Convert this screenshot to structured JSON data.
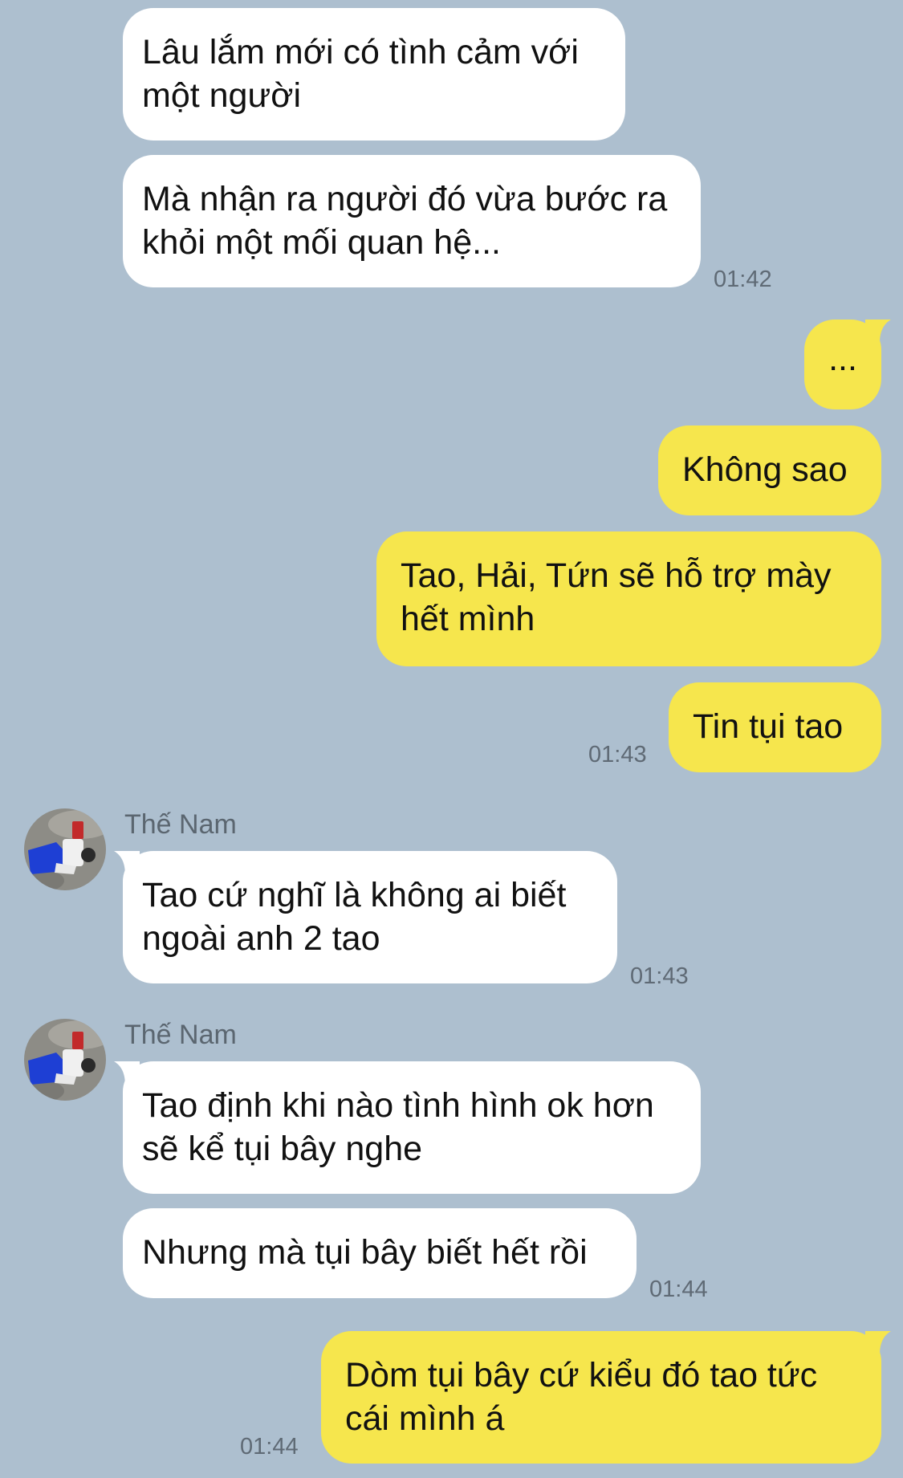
{
  "colors": {
    "background": "#adbfcf",
    "incoming_bubble": "#ffffff",
    "outgoing_bubble": "#f6e64d"
  },
  "messages": {
    "m1": {
      "text": "Lâu lắm mới có tình cảm với một người"
    },
    "m2": {
      "text": "Mà nhận ra người đó vừa bước ra khỏi một mối quan hệ...",
      "time": "01:42"
    },
    "m3": {
      "text": "..."
    },
    "m4": {
      "text": "Không sao"
    },
    "m5": {
      "text": "Tao, Hải, Tứn sẽ hỗ trợ mày hết mình"
    },
    "m6": {
      "text": "Tin tụi tao",
      "time": "01:43"
    },
    "m7": {
      "sender": "Thế Nam",
      "text": "Tao cứ nghĩ là không ai biết ngoài anh 2 tao",
      "time": "01:43"
    },
    "m8": {
      "sender": "Thế Nam",
      "text": "Tao định khi nào tình hình ok hơn sẽ kể tụi bây nghe"
    },
    "m9": {
      "text": "Nhưng mà tụi bây biết hết rồi",
      "time": "01:44"
    },
    "m10": {
      "text": "Dòm tụi bây cứ kiểu đó tao tức cái mình á",
      "time": "01:44"
    }
  }
}
